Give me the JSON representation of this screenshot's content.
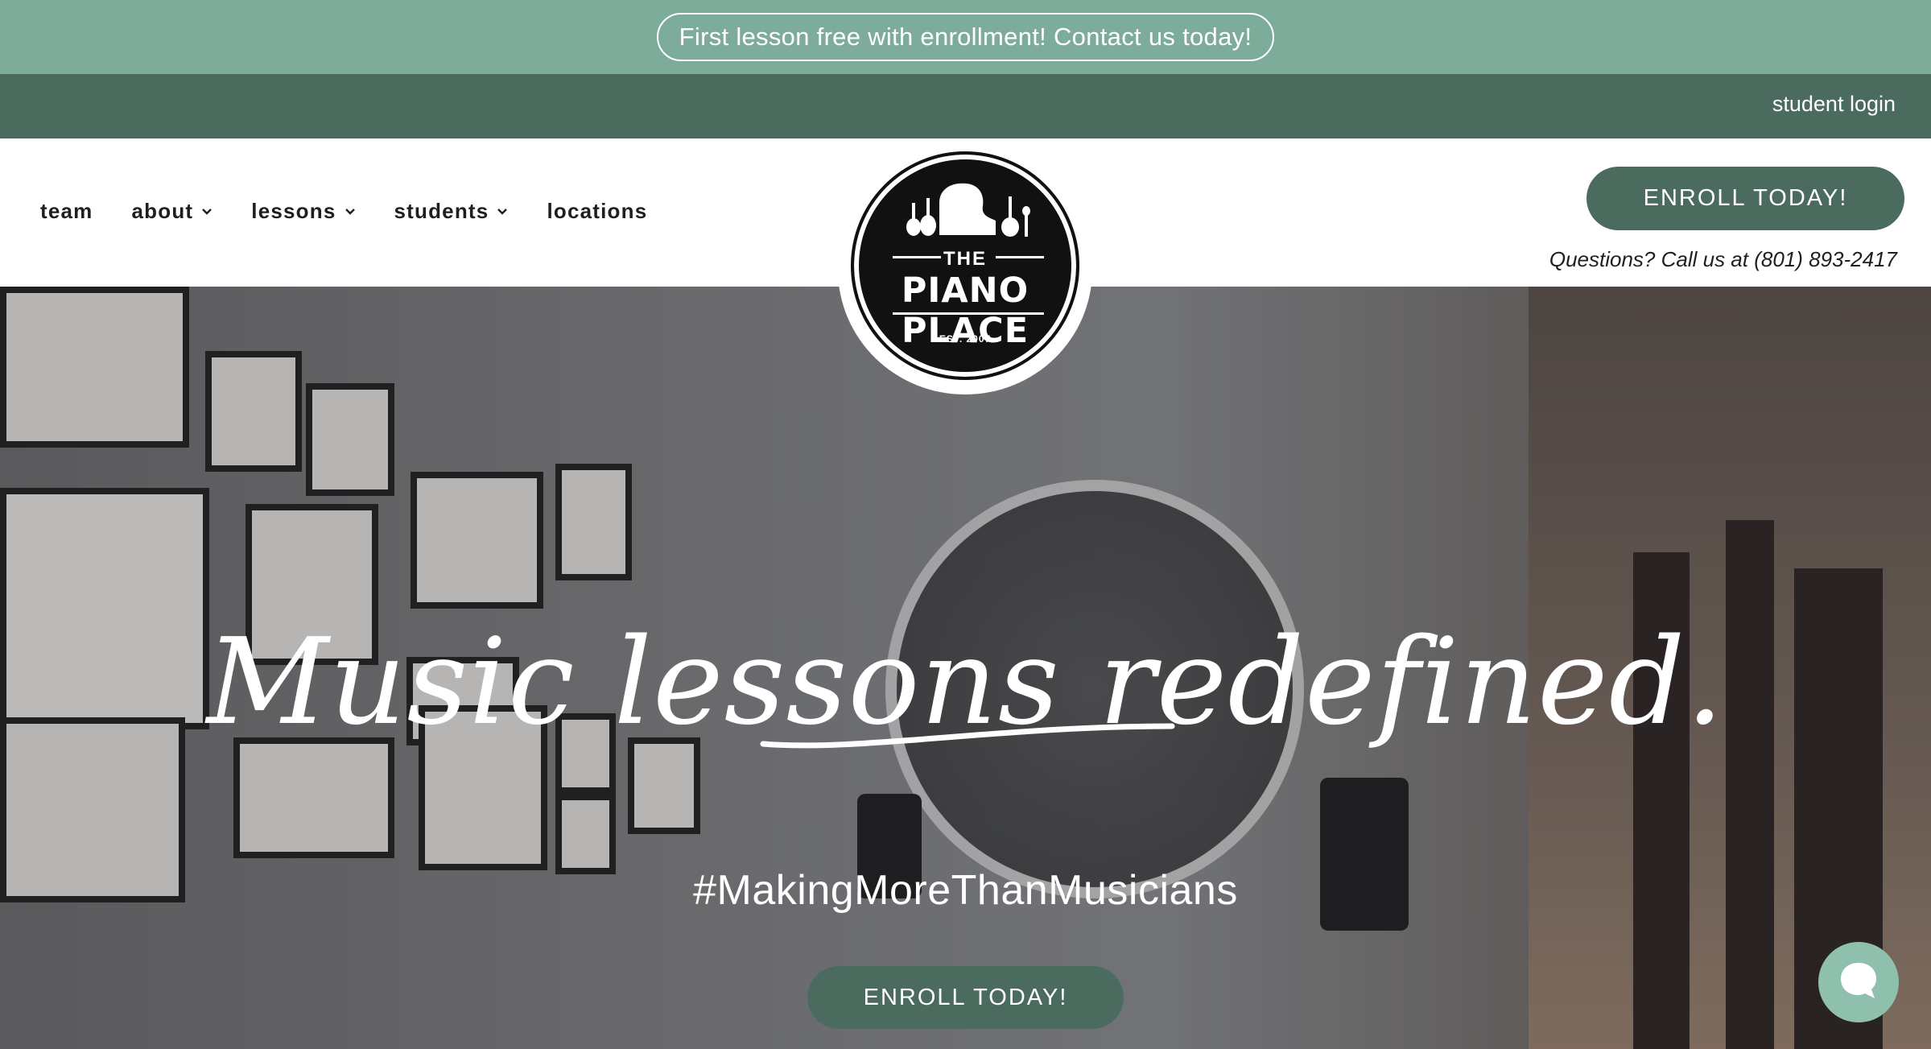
{
  "promo": {
    "text": "First lesson free with enrollment! Contact us today!"
  },
  "utility": {
    "student_login": "student login"
  },
  "nav": {
    "items": [
      {
        "label": "team",
        "has_dropdown": false
      },
      {
        "label": "about",
        "has_dropdown": true
      },
      {
        "label": "lessons",
        "has_dropdown": true
      },
      {
        "label": "students",
        "has_dropdown": true
      },
      {
        "label": "locations",
        "has_dropdown": false
      }
    ]
  },
  "logo": {
    "the": "THE",
    "name": "PIANO PLACE",
    "est": "EST. 2007"
  },
  "header": {
    "enroll_label": "ENROLL TODAY!",
    "questions": "Questions? Call us at (801) 893-2417"
  },
  "hero": {
    "headline": "Music lessons redefined.",
    "hashtag": "#MakingMoreThanMusicians",
    "enroll_label": "ENROLL TODAY!"
  },
  "colors": {
    "promo_bg": "#7eac9a",
    "utility_bg": "#4a6b5e",
    "button_bg": "#4a6b5e",
    "chat_bg": "#8fc0ad"
  },
  "icons": [
    "chevron-down-icon",
    "chat-bubble-icon",
    "piano-icon",
    "violin-icon",
    "guitar-icon",
    "microphone-icon"
  ]
}
